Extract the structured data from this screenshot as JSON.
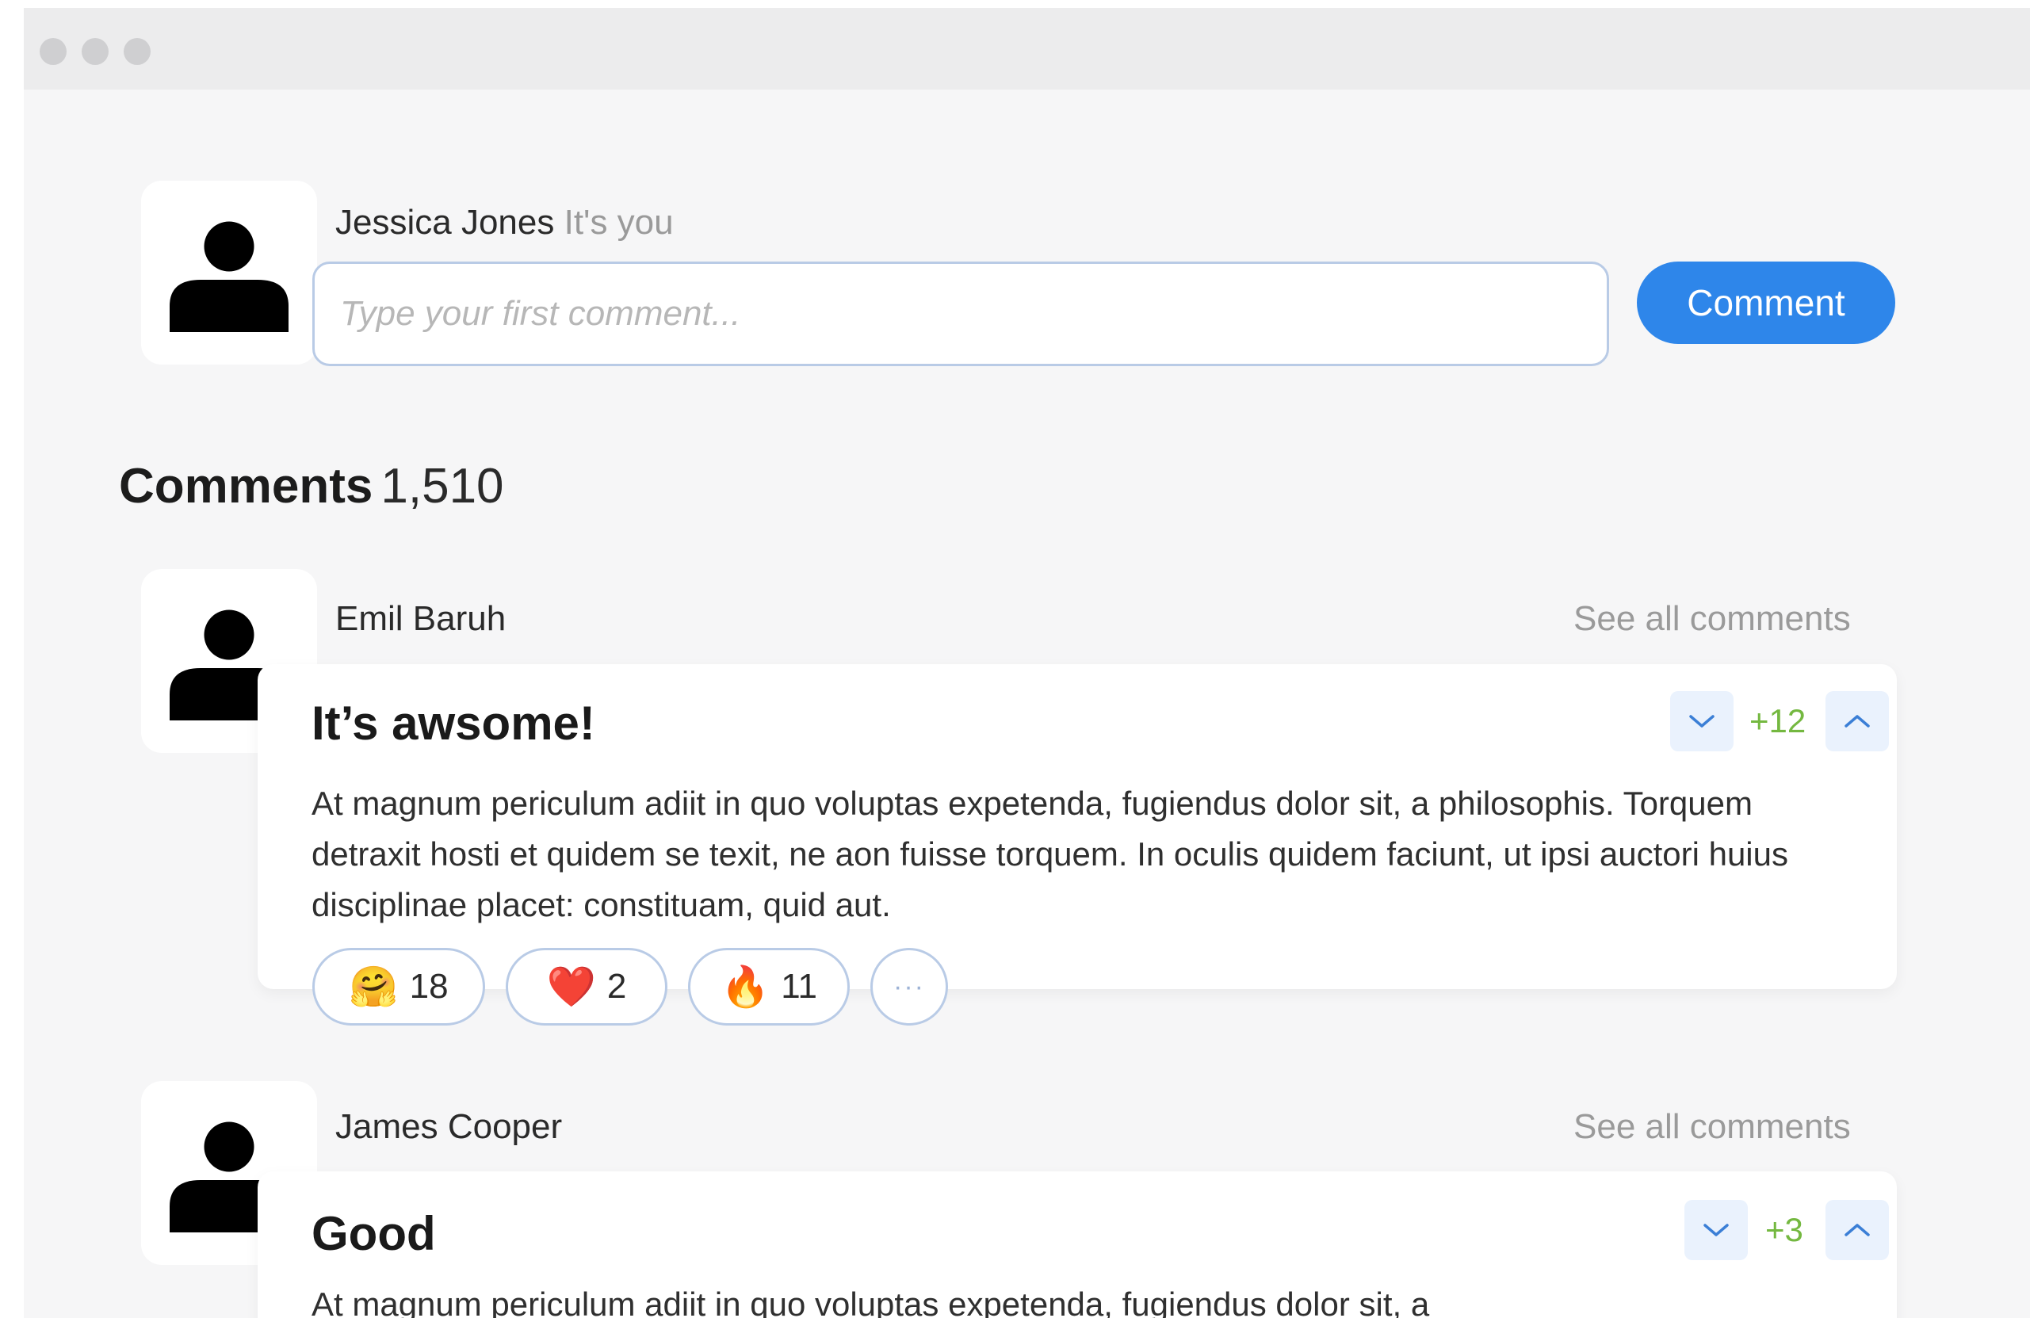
{
  "composer": {
    "user_name": "Jessica Jones",
    "user_note": "It's you",
    "placeholder": "Type your first comment...",
    "submit_label": "Comment"
  },
  "comments_section": {
    "label": "Comments",
    "count": "1,510"
  },
  "comments": [
    {
      "author": "Emil Baruh",
      "see_all": "See all comments",
      "title": "It’s awsome!",
      "body": "At magnum periculum adiit in quo voluptas expetenda, fugiendus dolor sit, a philosophis. Torquem detraxit hosti et quidem se texit, ne aon fuisse torquem. In oculis quidem faciunt, ut ipsi auctori huius disciplinae placet: constituam, quid aut.",
      "score": "+12",
      "reactions": [
        {
          "emoji": "🤗",
          "count": "18"
        },
        {
          "emoji": "❤️",
          "count": "2"
        },
        {
          "emoji": "🔥",
          "count": "11"
        }
      ],
      "more_reactions": "···"
    },
    {
      "author": "James Cooper",
      "see_all": "See all comments",
      "title": "Good",
      "body": "At magnum periculum adiit in quo voluptas expetenda, fugiendus dolor sit, a",
      "score": "+3"
    }
  ],
  "colors": {
    "accent": "#2e86ea",
    "score_positive": "#74b840",
    "muted_text": "#9a9a9a",
    "border": "#b9cbe6"
  },
  "icons": {
    "avatar": "person-icon",
    "downvote": "chevron-down-icon",
    "upvote": "chevron-up-icon",
    "more": "more-horizontal-icon"
  }
}
